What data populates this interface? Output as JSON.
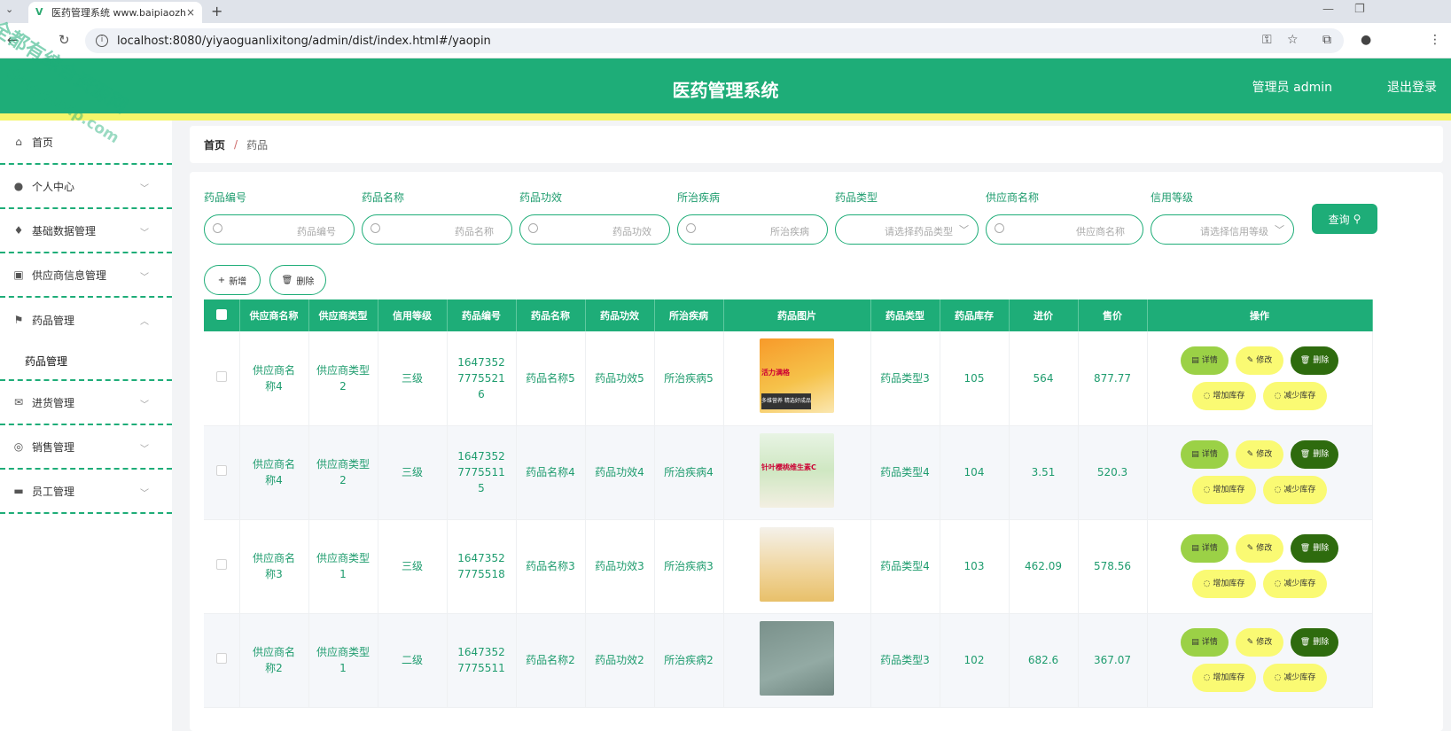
{
  "browser": {
    "tab_title": "医药管理系统 www.baipiaozh",
    "url": "localhost:8080/yiyaoguanlixitong/admin/dist/index.html#/yaopin",
    "new_tab": "+",
    "tab_close": "×"
  },
  "watermark": {
    "line1": "全都有综合资源网",
    "line2": "douyouvip.com"
  },
  "header": {
    "title": "医药管理系统",
    "user": "管理员 admin",
    "logout": "退出登录",
    "colors": {
      "primary": "#1ead78",
      "strip": "#f4f56a"
    }
  },
  "sidebar": {
    "items": [
      {
        "label": "首页",
        "icon": "home-icon",
        "glyph": "⌂",
        "has_arrow": false
      },
      {
        "label": "个人中心",
        "icon": "user-icon",
        "glyph": "●",
        "has_arrow": true
      },
      {
        "label": "基础数据管理",
        "icon": "mic-icon",
        "glyph": "♦",
        "has_arrow": true
      },
      {
        "label": "供应商信息管理",
        "icon": "truck-icon",
        "glyph": "▣",
        "has_arrow": true
      },
      {
        "label": "药品管理",
        "icon": "flag-icon",
        "glyph": "⚑",
        "has_arrow": true,
        "open": true
      },
      {
        "label": "进货管理",
        "icon": "mail-icon",
        "glyph": "✉",
        "has_arrow": true
      },
      {
        "label": "销售管理",
        "icon": "coin-icon",
        "glyph": "◎",
        "has_arrow": true
      },
      {
        "label": "员工管理",
        "icon": "briefcase-icon",
        "glyph": "▬",
        "has_arrow": true
      }
    ],
    "submenu": "药品管理"
  },
  "breadcrumb": {
    "home": "首页",
    "separator": "/",
    "current": "药品"
  },
  "filters": [
    {
      "label": "药品编号",
      "placeholder": "药品编号",
      "type": "input"
    },
    {
      "label": "药品名称",
      "placeholder": "药品名称",
      "type": "input"
    },
    {
      "label": "药品功效",
      "placeholder": "药品功效",
      "type": "input"
    },
    {
      "label": "所治疾病",
      "placeholder": "所治疾病",
      "type": "input"
    },
    {
      "label": "药品类型",
      "placeholder": "请选择药品类型",
      "type": "select"
    },
    {
      "label": "供应商名称",
      "placeholder": "供应商名称",
      "type": "input"
    },
    {
      "label": "信用等级",
      "placeholder": "请选择信用等级",
      "type": "select"
    }
  ],
  "buttons": {
    "query": "查询",
    "add": "新增",
    "delete": "删除"
  },
  "table": {
    "headers": [
      "供应商名称",
      "供应商类型",
      "信用等级",
      "药品编号",
      "药品名称",
      "药品功效",
      "所治疾病",
      "药品图片",
      "药品类型",
      "药品库存",
      "进价",
      "售价",
      "操作"
    ],
    "actions": {
      "detail": "详情",
      "edit": "修改",
      "delete": "删除",
      "add_stock": "增加库存",
      "reduce_stock": "减少库存"
    },
    "rows": [
      {
        "supplier_name": "供应商名称4",
        "supplier_type": "供应商类型2",
        "credit": "三级",
        "code": "164735277755216",
        "name": "药品名称5",
        "effect": "药品功效5",
        "disease": "所治疾病5",
        "image_caption": "多维营养 精选好成品",
        "image_title": "活力满格",
        "type": "药品类型3",
        "stock": "105",
        "cost": "564",
        "price": "877.77"
      },
      {
        "supplier_name": "供应商名称4",
        "supplier_type": "供应商类型2",
        "credit": "三级",
        "code": "164735277755115",
        "name": "药品名称4",
        "effect": "药品功效4",
        "disease": "所治疾病4",
        "image_caption": "",
        "image_title": "针叶樱桃维生素C",
        "type": "药品类型4",
        "stock": "104",
        "cost": "3.51",
        "price": "520.3"
      },
      {
        "supplier_name": "供应商名称3",
        "supplier_type": "供应商类型1",
        "credit": "三级",
        "code": "16473527775518",
        "name": "药品名称3",
        "effect": "药品功效3",
        "disease": "所治疾病3",
        "image_caption": "",
        "image_title": "",
        "type": "药品类型4",
        "stock": "103",
        "cost": "462.09",
        "price": "578.56"
      },
      {
        "supplier_name": "供应商名称2",
        "supplier_type": "供应商类型1",
        "credit": "二级",
        "code": "16473527775511",
        "name": "药品名称2",
        "effect": "药品功效2",
        "disease": "所治疾病2",
        "image_caption": "",
        "image_title": "",
        "type": "药品类型3",
        "stock": "102",
        "cost": "682.6",
        "price": "367.07"
      }
    ]
  }
}
